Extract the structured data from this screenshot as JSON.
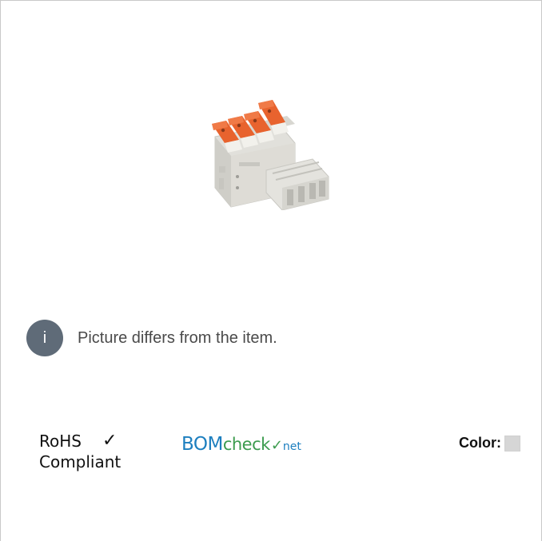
{
  "product": {
    "image_alt": "connector product image"
  },
  "notice": {
    "icon_glyph": "i",
    "text": "Picture differs from the item."
  },
  "compliance": {
    "rohs_line1": "RoHS",
    "rohs_check": "✓",
    "rohs_line2": "Compliant",
    "bomcheck_bom": "BOM",
    "bomcheck_check": "check",
    "bomcheck_mark": "✓",
    "bomcheck_net": "net"
  },
  "color": {
    "label": "Color:",
    "swatch_hex": "#d6d6d6"
  },
  "colors": {
    "info_icon_bg": "#5f6b78",
    "lever_orange": "#e8632e",
    "housing_gray": "#dcdbd6",
    "bom_blue": "#1d7fbf",
    "bom_green": "#3c9b4e"
  }
}
